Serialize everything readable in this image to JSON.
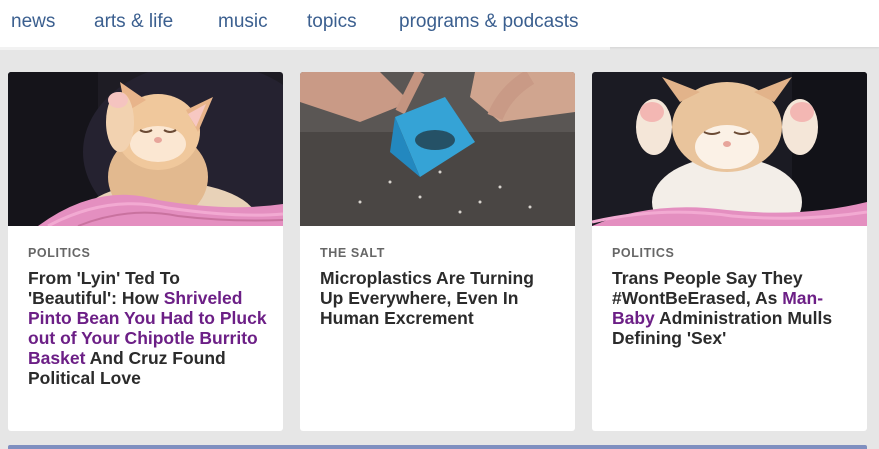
{
  "nav": {
    "items": [
      "news",
      "arts & life",
      "music",
      "topics",
      "programs & podcasts"
    ]
  },
  "cards": [
    {
      "image": "kitten-sleeping-image",
      "slug": "POLITICS",
      "headline_pre": "From 'Lyin' Ted To 'Beautiful': How ",
      "headline_highlight": "Shriveled Pinto Bean You Had to Pluck out of Your Chipotle Burrito Basket",
      "headline_post": " And Cruz Found Political Love"
    },
    {
      "image": "microplastics-beach-image",
      "slug": "THE SALT",
      "headline_pre": "Microplastics Are Turning Up Everywhere, Even In Human Excrement",
      "headline_highlight": "",
      "headline_post": ""
    },
    {
      "image": "kitten-stretching-image",
      "slug": "POLITICS",
      "headline_pre": "Trans People Say They #WontBeErased, As ",
      "headline_highlight": "Man-Baby",
      "headline_post": " Administration Mulls Defining 'Sex'"
    }
  ],
  "colors": {
    "nav_text": "#3b5f8f",
    "highlight": "#6c1f86",
    "headline": "#2b2b2b",
    "slug": "#666666"
  }
}
